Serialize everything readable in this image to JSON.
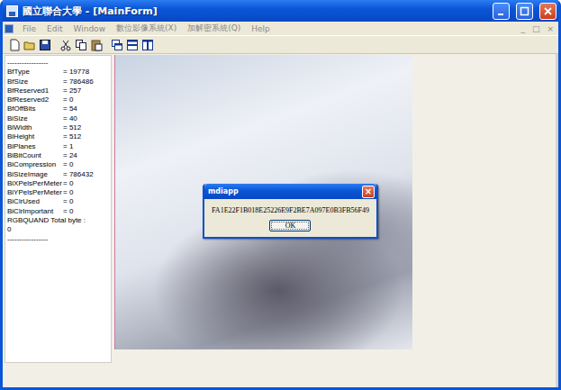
{
  "window": {
    "title": "國立聯合大學 - [MainForm]",
    "controls": [
      {
        "kind": "min"
      },
      {
        "kind": "max"
      },
      {
        "kind": "close"
      }
    ]
  },
  "menu": [
    {
      "label": "File",
      "disabled": true
    },
    {
      "label": "Edit",
      "disabled": true
    },
    {
      "label": "Window",
      "disabled": true
    },
    {
      "label": "數位影像系統(X)",
      "disabled": true
    },
    {
      "label": "加解密系統(Q)",
      "disabled": true
    },
    {
      "label": "Help",
      "disabled": true
    }
  ],
  "mdi_controls": [
    "_",
    "□",
    "×"
  ],
  "info_panel": {
    "separator": "=",
    "lines": [
      {
        "kind": "text",
        "text": "-----------------"
      },
      {
        "kind": "field",
        "key": "BfType",
        "value": "19778"
      },
      {
        "kind": "field",
        "key": "BfSize",
        "value": "786486"
      },
      {
        "kind": "field",
        "key": "BfReserved1",
        "value": "257"
      },
      {
        "kind": "field",
        "key": "BfReserved2",
        "value": "0"
      },
      {
        "kind": "field",
        "key": "BfOffBits",
        "value": "54"
      },
      {
        "kind": "field",
        "key": "BiSize",
        "value": "40"
      },
      {
        "kind": "field",
        "key": "BiWidth",
        "value": "512"
      },
      {
        "kind": "field",
        "key": "BiHeight",
        "value": "512"
      },
      {
        "kind": "field",
        "key": "BiPlanes",
        "value": "1"
      },
      {
        "kind": "field",
        "key": "BiBitCount",
        "value": "24"
      },
      {
        "kind": "field",
        "key": "BiCompression",
        "value": "0"
      },
      {
        "kind": "field",
        "key": "BiSizeImage",
        "value": "786432"
      },
      {
        "kind": "field",
        "key": "BiXPelsPerMeter",
        "value": "0"
      },
      {
        "kind": "field",
        "key": "BiYPelsPerMeter",
        "value": "0"
      },
      {
        "kind": "field",
        "key": "BiClrUsed",
        "value": "0"
      },
      {
        "kind": "field",
        "key": "BiClrImportant",
        "value": "0"
      },
      {
        "kind": "text",
        "text": "RGBQUAND Total byte :"
      },
      {
        "kind": "text",
        "text": "0"
      },
      {
        "kind": "text",
        "text": "-----------------"
      }
    ]
  },
  "dialog": {
    "title": "mdiapp",
    "close": "×",
    "message": "FA1E22F1B018E25226E9F2BE7A097E0B3FB56F49",
    "buttons": [
      "OK"
    ]
  }
}
